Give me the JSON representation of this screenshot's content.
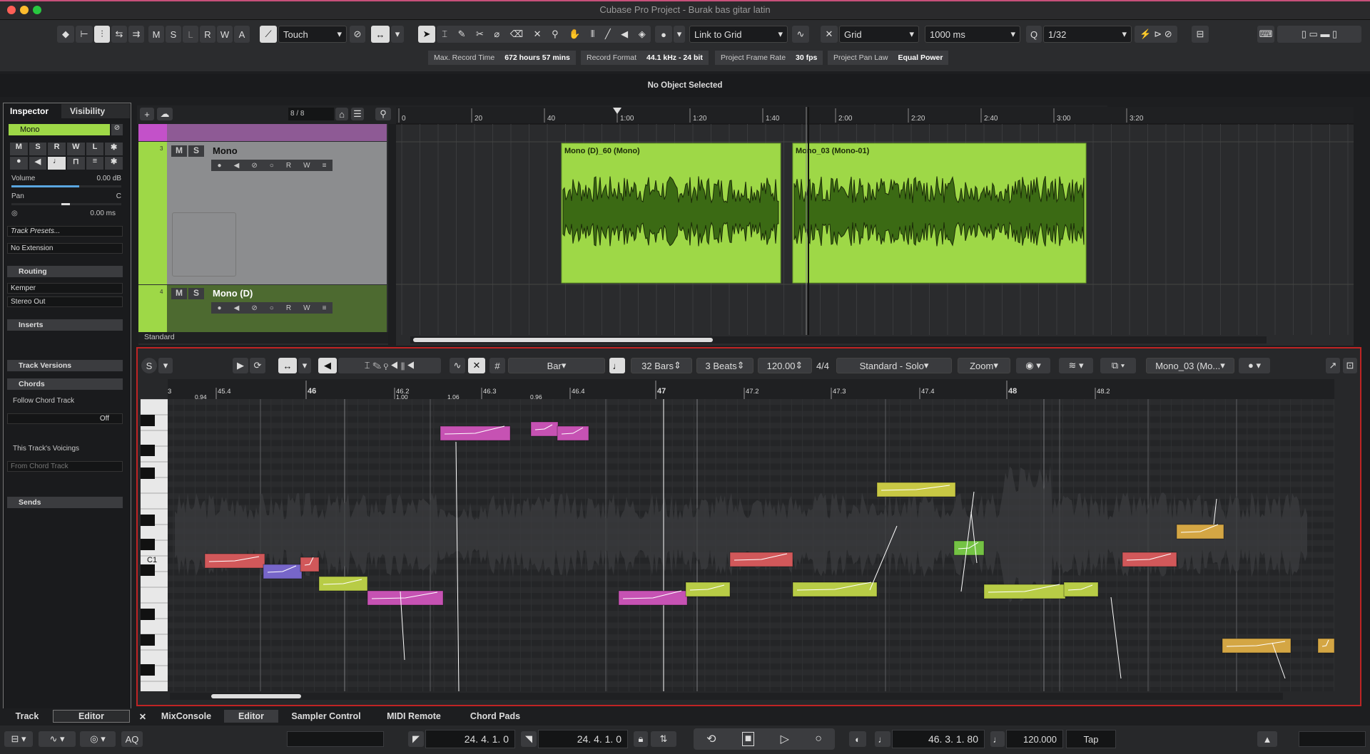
{
  "window": {
    "title": "Cubase Pro Project - Burak bas gitar latin"
  },
  "toolbar": {
    "m": "M",
    "s": "S",
    "l": "L",
    "r": "R",
    "w": "W",
    "a": "A",
    "automation_mode": "Touch",
    "link": "Link to Grid",
    "snap_type": "Grid",
    "grid_size": "1000 ms",
    "quantize": "1/32"
  },
  "info": {
    "rec_time_label": "Max. Record Time",
    "rec_time": "672 hours 57 mins",
    "format_label": "Record Format",
    "format": "44.1 kHz - 24 bit",
    "frame_label": "Project Frame Rate",
    "frame": "30 fps",
    "pan_label": "Project Pan Law",
    "pan": "Equal Power"
  },
  "status": "No Object Selected",
  "inspector": {
    "tab_inspector": "Inspector",
    "tab_visibility": "Visibility",
    "track_name": "Mono",
    "volume_label": "Volume",
    "volume": "0.00 dB",
    "pan_label": "Pan",
    "pan": "C",
    "delay": "0.00 ms",
    "presets": "Track Presets...",
    "extension": "No Extension",
    "routing": "Routing",
    "input": "Kemper",
    "output": "Stereo Out",
    "inserts": "Inserts",
    "versions": "Track Versions",
    "chords": "Chords",
    "follow": "Follow Chord Track",
    "off": "Off",
    "voicings": "This Track's Voicings",
    "from_chord": "From Chord Track",
    "sends": "Sends"
  },
  "arrange": {
    "track_count": "8 / 8",
    "standard": "Standard",
    "ruler": [
      "0",
      "20",
      "40",
      "1:00",
      "1:20",
      "1:40",
      "2:00",
      "2:20",
      "2:40",
      "3:00",
      "3:20"
    ],
    "tracks": [
      {
        "num": "3",
        "name": "Mono"
      },
      {
        "num": "4",
        "name": "Mono (D)"
      }
    ],
    "clips": [
      "Mono (D)_60 (Mono)",
      "Mono_03 (Mono-01)"
    ]
  },
  "editor": {
    "bar": "Bar",
    "bars": "32 Bars",
    "beats": "3 Beats",
    "tempo": "120.00",
    "sig": "4/4",
    "mode": "Standard - Solo",
    "zoom": "Zoom",
    "clip": "Mono_03 (Mo...",
    "key_label": "C1",
    "ruler": [
      "3",
      "45.4",
      "46",
      "46.2",
      "46.3",
      "46.4",
      "47",
      "47.2",
      "47.3",
      "47.4",
      "48",
      "48.2"
    ],
    "markers": [
      "0.94",
      "1.00",
      "1.06",
      "0.96"
    ]
  },
  "tabs": {
    "track": "Track",
    "editor": "Editor",
    "mix": "MixConsole",
    "editor2": "Editor",
    "sampler": "Sampler Control",
    "midi": "MIDI Remote",
    "pads": "Chord Pads"
  },
  "transport": {
    "aq": "AQ",
    "left": "24. 4. 1.   0",
    "right": "24. 4. 1.   0",
    "pos": "46. 3. 1. 80",
    "tempo": "120.000",
    "tap": "Tap"
  }
}
